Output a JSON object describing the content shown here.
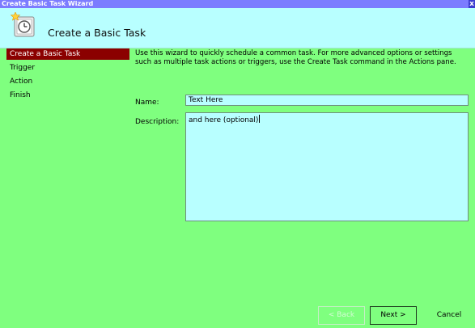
{
  "window": {
    "title": "Create Basic Task Wizard",
    "close_glyph": "x"
  },
  "header": {
    "icon": "clock-task-icon",
    "title": "Create a Basic Task"
  },
  "sidebar": {
    "items": [
      {
        "label": "Create a Basic Task",
        "active": true
      },
      {
        "label": "Trigger",
        "active": false
      },
      {
        "label": "Action",
        "active": false
      },
      {
        "label": "Finish",
        "active": false
      }
    ]
  },
  "main": {
    "intro_line1": "Use this wizard to quickly schedule a common task.  For more advanced options or settings",
    "intro_line2": "such as multiple task actions or triggers, use the Create Task command in the Actions pane.",
    "name_label": "Name:",
    "name_value": "Text Here",
    "description_label": "Description:",
    "description_value": "and here (optional)"
  },
  "buttons": {
    "back": "< Back",
    "next": "Next >",
    "cancel": "Cancel"
  },
  "colors": {
    "background": "#7fff7f",
    "header": "#b8ffff",
    "titlebar": "#7c7cff",
    "active_nav": "#8b0000"
  }
}
